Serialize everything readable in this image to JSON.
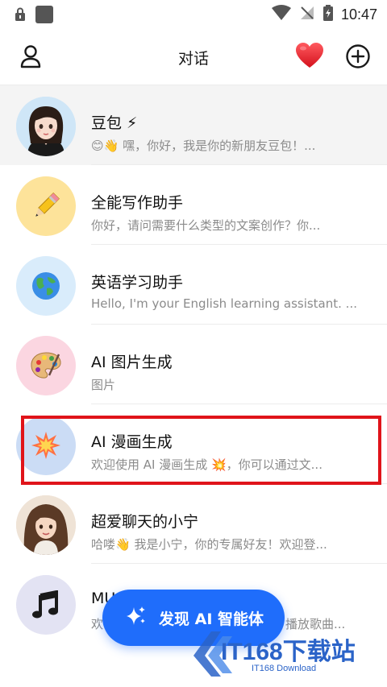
{
  "status_bar": {
    "time": "10:47"
  },
  "header": {
    "title": "对话",
    "icons": {
      "left": "profile-icon",
      "heart": "heart-icon",
      "right": "add-icon"
    }
  },
  "conversations": [
    {
      "name": "豆包 ⚡",
      "preview": "😊👋 嘿，你好，我是你的新朋友豆包！...",
      "avatar": "doubao-avatar"
    },
    {
      "name": "全能写作助手",
      "preview": "你好，请问需要什么类型的文案创作？你...",
      "avatar": "pencil-icon"
    },
    {
      "name": "英语学习助手",
      "preview": "Hello, I'm your English learning assistant. ...",
      "avatar": "globe-icon"
    },
    {
      "name": "AI 图片生成",
      "preview": "图片",
      "avatar": "palette-icon"
    },
    {
      "name": "AI 漫画生成",
      "preview": "欢迎使用 AI 漫画生成 💥，你可以通过文...",
      "avatar": "explosion-icon"
    },
    {
      "name": "超爱聊天的小宁",
      "preview": "哈喽👋 我是小宁，你的专属好友！欢迎登...",
      "avatar": "xiaoning-avatar"
    },
    {
      "name": "MU",
      "preview": "欢",
      "preview_tail": "播放歌曲...",
      "avatar": "music-note-icon"
    }
  ],
  "fab": {
    "label": "发现 AI 智能体",
    "icon": "sparkle-icon"
  },
  "watermark": {
    "text": "IT168下载站",
    "sub": "IT168 Download"
  },
  "colors": {
    "accent": "#1f6dfb",
    "highlight": "#e0141a",
    "heart": "#e8232f"
  }
}
